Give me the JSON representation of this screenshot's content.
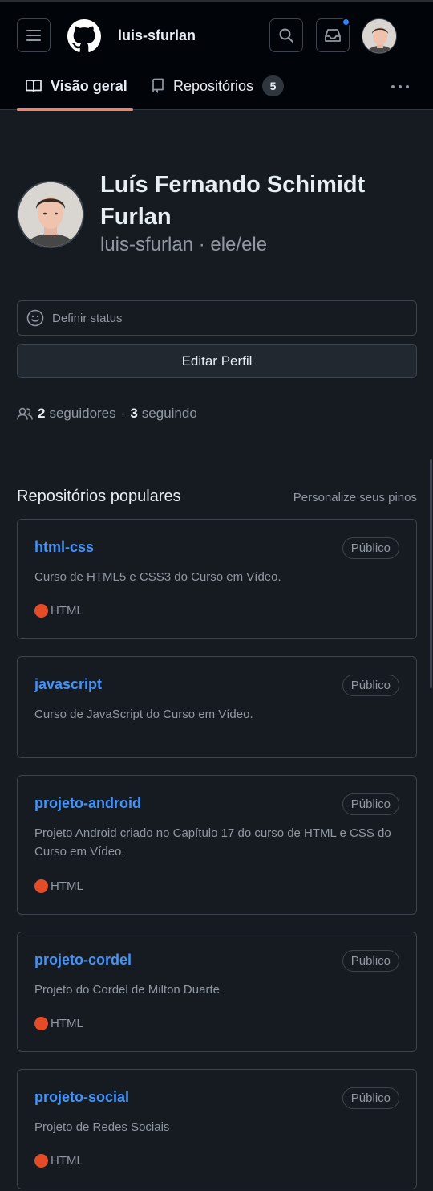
{
  "header": {
    "username": "luis-sfurlan",
    "tabs": [
      {
        "label": "Visão geral",
        "active": true
      },
      {
        "label": "Repositórios",
        "count": "5"
      }
    ]
  },
  "profile": {
    "full_name": "Luís Fernando Schimidt Furlan",
    "handle_line": "luis-sfurlan · ele/ele",
    "status_placeholder": "Definir status",
    "edit_button": "Editar Perfil",
    "followers_count": "2",
    "followers_label": "seguidores",
    "following_count": "3",
    "following_label": "seguindo"
  },
  "popular": {
    "title": "Repositórios populares",
    "customize_label": "Personalize seus pinos",
    "repos": [
      {
        "name": "html-css",
        "visibility": "Público",
        "description": "Curso de HTML5 e CSS3 do Curso em Vídeo.",
        "language": "HTML",
        "language_color": "#e34c26"
      },
      {
        "name": "javascript",
        "visibility": "Público",
        "description": "Curso de JavaScript do Curso em Vídeo.",
        "language": "",
        "language_color": ""
      },
      {
        "name": "projeto-android",
        "visibility": "Público",
        "description": "Projeto Android criado no Capítulo 17 do curso de HTML e CSS do Curso em Vídeo.",
        "language": "HTML",
        "language_color": "#e34c26"
      },
      {
        "name": "projeto-cordel",
        "visibility": "Público",
        "description": "Projeto do Cordel de Milton Duarte",
        "language": "HTML",
        "language_color": "#e34c26"
      },
      {
        "name": "projeto-social",
        "visibility": "Público",
        "description": "Projeto de Redes Sociais",
        "language": "HTML",
        "language_color": "#e34c26"
      }
    ]
  },
  "colors": {
    "accent_link": "#4493f8",
    "tab_underline": "#f78166",
    "notification_dot": "#2f81f7",
    "background": "#161b22",
    "header_background": "#010409"
  },
  "icons": [
    "hamburger-menu-icon",
    "github-logo-icon",
    "search-icon",
    "inbox-icon",
    "book-icon",
    "repo-icon",
    "kebab-icon",
    "smiley-icon",
    "people-icon"
  ]
}
